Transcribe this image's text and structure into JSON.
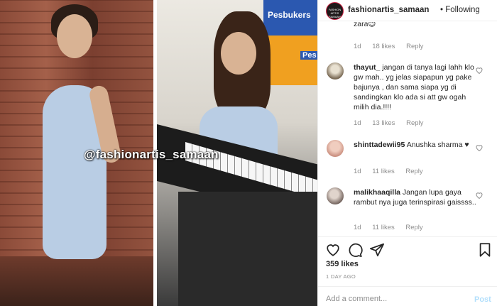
{
  "header": {
    "username": "fashionartis_samaan",
    "separator": "•",
    "follow_status": "Following",
    "avatar_text": "FASHION ARTIS SAMAAN"
  },
  "photo": {
    "watermark": "@fashionartis_samaan",
    "sign_text": "Pesbukers",
    "sign_text_partial": "Pes"
  },
  "comments": [
    {
      "user": "",
      "text": "zara😉",
      "time": "1d",
      "likes": "18 likes",
      "reply": "Reply"
    },
    {
      "user": "thayut_",
      "text": "jangan di tanya lagi lahh klo gw mah.. yg jelas siapapun yg pake bajunya , dan sama siapa yg di sandingkan klo ada si att gw ogah milih dia.!!!!",
      "time": "1d",
      "likes": "13 likes",
      "reply": "Reply"
    },
    {
      "user": "shinttadewii95",
      "text": "Anushka sharma ♥",
      "time": "1d",
      "likes": "11 likes",
      "reply": "Reply"
    },
    {
      "user": "malikhaaqilla",
      "text": "Jangan lupa gaya rambut nya juga terinspirasi gaissss..",
      "time": "1d",
      "likes": "11 likes",
      "reply": "Reply"
    }
  ],
  "actions": {
    "like_icon": "heart-icon",
    "comment_icon": "comment-icon",
    "share_icon": "share-icon",
    "save_icon": "bookmark-icon"
  },
  "likes_count": "359 likes",
  "timestamp": "1 DAY AGO",
  "add_comment": {
    "placeholder": "Add a comment...",
    "post_label": "Post"
  },
  "colors": {
    "text": "#262626",
    "muted": "#8e8e8e",
    "post_disabled": "#b2dffc",
    "border": "#efefef"
  }
}
